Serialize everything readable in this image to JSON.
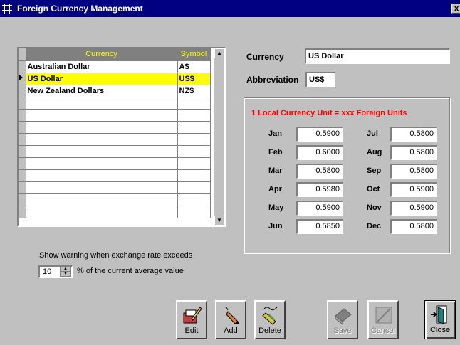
{
  "window": {
    "title": "Foreign Currency Management",
    "close_glyph": "X"
  },
  "grid": {
    "headers": [
      "Currency",
      "Symbol"
    ],
    "rows": [
      {
        "currency": "Australian Dollar",
        "symbol": "A$"
      },
      {
        "currency": "US Dollar",
        "symbol": "US$",
        "selected": true
      },
      {
        "currency": "New Zealand Dollars",
        "symbol": "NZ$"
      }
    ],
    "blank_rows": 10
  },
  "details": {
    "currency_label": "Currency",
    "currency_value": "US Dollar",
    "abbreviation_label": "Abbreviation",
    "abbreviation_value": "US$"
  },
  "rates": {
    "title": "1 Local Currency Unit = xxx Foreign Units",
    "months": [
      {
        "label": "Jan",
        "value": "0.5900"
      },
      {
        "label": "Feb",
        "value": "0.6000"
      },
      {
        "label": "Mar",
        "value": "0.5800"
      },
      {
        "label": "Apr",
        "value": "0.5980"
      },
      {
        "label": "May",
        "value": "0.5900"
      },
      {
        "label": "Jun",
        "value": "0.5850"
      },
      {
        "label": "Jul",
        "value": "0.5800"
      },
      {
        "label": "Aug",
        "value": "0.5800"
      },
      {
        "label": "Sep",
        "value": "0.5800"
      },
      {
        "label": "Oct",
        "value": "0.5900"
      },
      {
        "label": "Nov",
        "value": "0.5900"
      },
      {
        "label": "Dec",
        "value": "0.5800"
      }
    ]
  },
  "warning": {
    "text": "Show warning when exchange rate exceeds",
    "value": "10",
    "suffix": "% of the current average value"
  },
  "buttons": {
    "edit": "Edit",
    "add": "Add",
    "delete": "Delete",
    "save": "Save",
    "cancel": "Cancel",
    "close": "Close"
  },
  "colors": {
    "titlebar": "#000080",
    "selected_row": "#ffff00",
    "rate_title": "#ff0000",
    "header_text": "#ffff00"
  }
}
